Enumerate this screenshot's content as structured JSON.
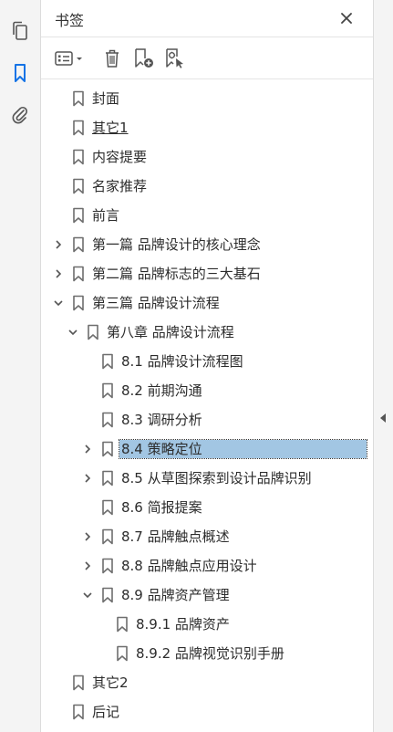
{
  "rail": {
    "icons": [
      "pages-icon",
      "bookmark-icon",
      "attachment-icon"
    ]
  },
  "panel": {
    "title": "书签"
  },
  "toolbar": {
    "options_icon": "options-list-icon",
    "delete_icon": "trash-icon",
    "new_bookmark_icon": "new-bookmark-icon",
    "new_from_structure_icon": "bookmark-structure-icon"
  },
  "bookmarks": [
    {
      "label": "封面",
      "level": 0,
      "chevron": "none"
    },
    {
      "label": "其它1",
      "level": 0,
      "chevron": "none",
      "underline": true
    },
    {
      "label": "内容提要",
      "level": 0,
      "chevron": "none"
    },
    {
      "label": "名家推荐",
      "level": 0,
      "chevron": "none"
    },
    {
      "label": "前言",
      "level": 0,
      "chevron": "none"
    },
    {
      "label": "第一篇 品牌设计的核心理念",
      "level": 0,
      "chevron": "right"
    },
    {
      "label": "第二篇 品牌标志的三大基石",
      "level": 0,
      "chevron": "right"
    },
    {
      "label": "第三篇 品牌设计流程",
      "level": 0,
      "chevron": "down"
    },
    {
      "label": "第八章 品牌设计流程",
      "level": 1,
      "chevron": "down"
    },
    {
      "label": "8.1 品牌设计流程图",
      "level": 2,
      "chevron": "none"
    },
    {
      "label": "8.2 前期沟通",
      "level": 2,
      "chevron": "none"
    },
    {
      "label": "8.3 调研分析",
      "level": 2,
      "chevron": "none"
    },
    {
      "label": "8.4 策略定位",
      "level": 2,
      "chevron": "right",
      "selected": true
    },
    {
      "label": "8.5 从草图探索到设计品牌识别",
      "level": 2,
      "chevron": "right"
    },
    {
      "label": "8.6 简报提案",
      "level": 2,
      "chevron": "none"
    },
    {
      "label": "8.7 品牌触点概述",
      "level": 2,
      "chevron": "right"
    },
    {
      "label": "8.8 品牌触点应用设计",
      "level": 2,
      "chevron": "right"
    },
    {
      "label": "8.9 品牌资产管理",
      "level": 2,
      "chevron": "down"
    },
    {
      "label": "8.9.1 品牌资产",
      "level": 3,
      "chevron": "none"
    },
    {
      "label": "8.9.2 品牌视觉识别手册",
      "level": 3,
      "chevron": "none"
    },
    {
      "label": "其它2",
      "level": 0,
      "chevron": "none"
    },
    {
      "label": "后记",
      "level": 0,
      "chevron": "none"
    }
  ],
  "colors": {
    "accent": "#1473e6",
    "selected_bg": "#a2c6e3",
    "icon_gray": "#6e6e6e"
  }
}
